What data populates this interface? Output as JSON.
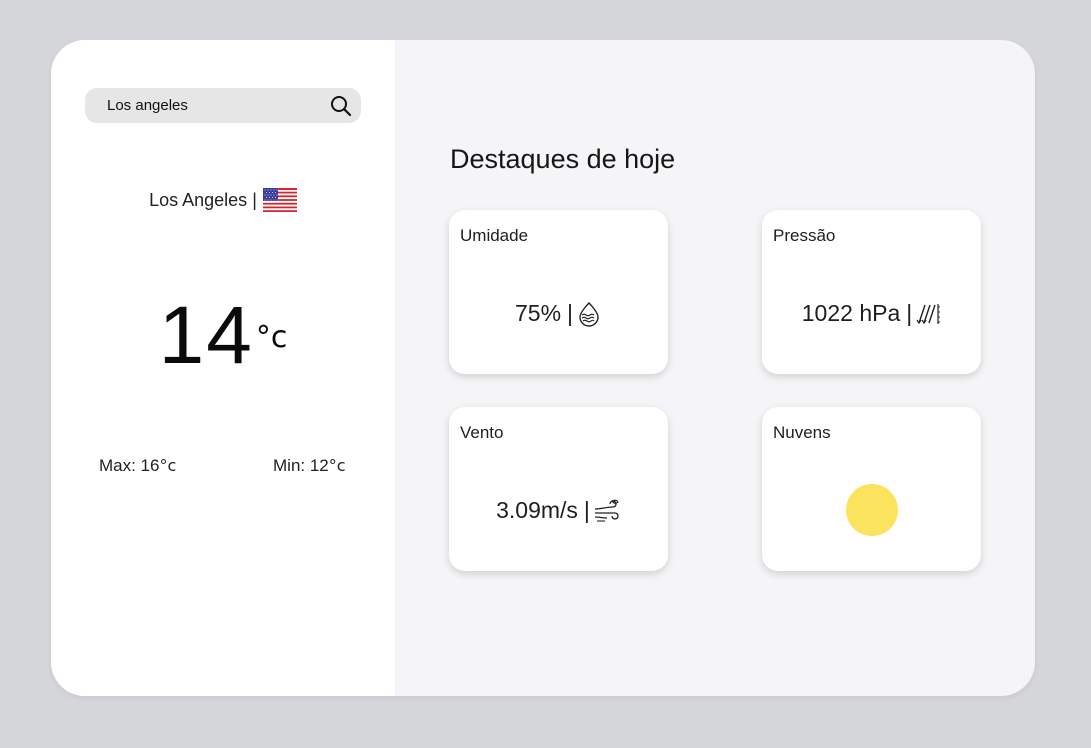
{
  "search": {
    "value": "Los angeles",
    "icon": "search-icon"
  },
  "location": {
    "city": "Los Angeles",
    "separator": "|",
    "flag": "us-flag"
  },
  "current": {
    "temperature": "14",
    "unit": "°c"
  },
  "range": {
    "max_label": "Max: 16",
    "min_label": "Min: 12",
    "unit": "°c"
  },
  "highlights": {
    "title": "Destaques de hoje",
    "humidity": {
      "label": "Umidade",
      "value": "75%",
      "separator": "|",
      "icon": "humidity-icon"
    },
    "pressure": {
      "label": "Pressão",
      "value": "1022 hPa",
      "separator": "|",
      "icon": "pressure-icon"
    },
    "wind": {
      "label": "Vento",
      "value": "3.09m/s",
      "separator": "|",
      "icon": "wind-icon"
    },
    "clouds": {
      "label": "Nuvens",
      "icon": "sun-icon"
    }
  },
  "colors": {
    "page_bg": "#d5d6da",
    "left_panel": "#ffffff",
    "right_panel": "#f5f5f7",
    "search_bg": "#e6e6e6",
    "sun": "#fce35e"
  }
}
